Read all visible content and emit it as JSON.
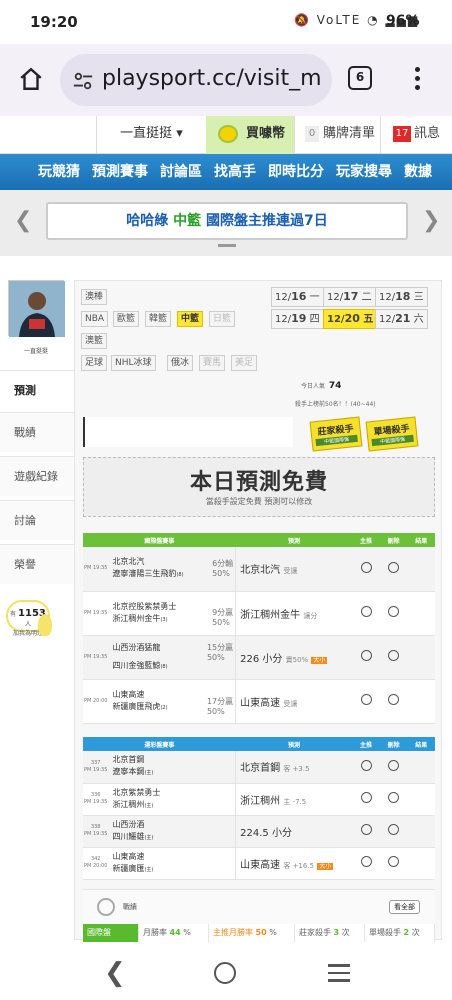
{
  "status_bar": {
    "time": "19:20",
    "icons": "🔕 VoLTE ◔ ▂▄▆",
    "battery": "96%"
  },
  "browser": {
    "url": "playsport.cc/visit_m",
    "tab_count": "6"
  },
  "top_nav": {
    "user": "一直挺挺 ▾",
    "buy": "買噱幣",
    "list_count": "0",
    "list": "購牌清單",
    "msg_count": "17",
    "msg": "訊息"
  },
  "main_nav": [
    "玩競猜",
    "預測賽事",
    "討論區",
    "找高手",
    "即時比分",
    "玩家搜尋",
    "數據"
  ],
  "banner": {
    "prefix": "哈哈綠",
    "highlight": "中籃",
    "suffix": "國際盤主推連過7日"
  },
  "profile": {
    "name": "一直挺挺"
  },
  "side_tabs": [
    "預測",
    "戰績",
    "遊戲紀錄",
    "討論",
    "榮譽"
  ],
  "fan": {
    "prefix": "有",
    "count": "1153",
    "suffix": "人",
    "line2": "加我為明燈"
  },
  "sports": {
    "row1": [
      "澳棒"
    ],
    "row2": [
      "NBA",
      "歐籃",
      "韓籃",
      "中籃",
      "日籃"
    ],
    "row3": [
      "澳籃"
    ],
    "row4": [
      "足球",
      "NHL冰球",
      "俄冰",
      "賽馬",
      "美足"
    ]
  },
  "dates": [
    {
      "md": "12/",
      "d": "16",
      "wd": "一"
    },
    {
      "md": "12/",
      "d": "17",
      "wd": "二"
    },
    {
      "md": "12/",
      "d": "18",
      "wd": "三"
    },
    {
      "md": "12/",
      "d": "19",
      "wd": "四"
    },
    {
      "md": "12/",
      "d": "20",
      "wd": "五"
    },
    {
      "md": "12/",
      "d": "21",
      "wd": "六"
    }
  ],
  "stats": {
    "today_label": "今日人氣",
    "today_value": "74",
    "rank_text": "殺手上榜前50名！！(40~44)"
  },
  "ranks": [
    {
      "title": "莊家殺手",
      "sub": "中籃國際盤"
    },
    {
      "title": "單場殺手",
      "sub": "中籃國際盤"
    }
  ],
  "free": {
    "title": "本日預測免費",
    "sub": "當殺手設定免費 預測可以修改"
  },
  "intl_table": {
    "headers": [
      "國際盤賽事",
      "預測",
      "主推",
      "刪除",
      "結果"
    ],
    "rows": [
      {
        "time_a": "PM",
        "time_b": "19:35",
        "home": "北京北汽",
        "away": "遼寧瀋陽三生飛豹",
        "away_rank": "(8)",
        "line": "6分輸",
        "pct": "50%",
        "pick": "北京北汽",
        "pick_note": "受讓",
        "tag": ""
      },
      {
        "time_a": "PM",
        "time_b": "19:35",
        "home": "北京控股紫禁勇士",
        "away": "浙江稠州金牛",
        "away_rank": "(3)",
        "line": "9分贏",
        "pct": "50%",
        "pick": "浙江稠州金牛",
        "pick_note": "讓分",
        "tag": ""
      },
      {
        "time_a": "PM",
        "time_b": "19:35",
        "home": "山西汾酒猛龍",
        "away": "四川金強藍鯨",
        "away_rank": "(8)",
        "line": "15分贏",
        "pct": "50%",
        "pick": "226 小分",
        "pick_note": "賣50%",
        "tag": "大小"
      },
      {
        "time_a": "PM",
        "time_b": "20:00",
        "home": "山東高速",
        "away": "新疆廣匯飛虎",
        "away_rank": "(2)",
        "line": "17分贏",
        "pct": "50%",
        "pick": "山東高速",
        "pick_note": "受讓",
        "tag": ""
      }
    ]
  },
  "local_table": {
    "headers": [
      "運彩盤賽事",
      "預測",
      "主推",
      "刪除",
      "結果"
    ],
    "rows": [
      {
        "num": "337",
        "time": "PM 19:35",
        "home": "北京首鋼",
        "away": "遼寧本鋼",
        "away_rank": "(主)",
        "pick": "北京首鋼",
        "pick_note": "客 +3.5",
        "tag": ""
      },
      {
        "num": "336",
        "time": "PM 19:35",
        "home": "北京紫禁勇士",
        "away": "浙江稠州",
        "away_rank": "(主)",
        "pick": "浙江稠州",
        "pick_note": "主 -7.5",
        "tag": ""
      },
      {
        "num": "338",
        "time": "PM 19:35",
        "home": "山西汾酒",
        "away": "四川鱷雄",
        "away_rank": "(主)",
        "pick": "224.5 小分",
        "pick_note": "",
        "tag": ""
      },
      {
        "num": "342",
        "time": "PM 20:00",
        "home": "山東高速",
        "away": "新疆廣匯",
        "away_rank": "(主)",
        "pick": "山東高速",
        "pick_note": "客 +16.5",
        "tag": "大小"
      }
    ]
  },
  "streak": {
    "label": "戰績",
    "all": "看全部",
    "cells": [
      {
        "name": "國際盤",
        "value": ""
      },
      {
        "name": "月勝率",
        "value": "44",
        "unit": "%"
      },
      {
        "name": "主推月勝率",
        "value": "50",
        "unit": "%"
      },
      {
        "name": "莊家殺手",
        "value": "3",
        "unit": "次"
      },
      {
        "name": "單場殺手",
        "value": "2",
        "unit": "次"
      }
    ]
  },
  "colors": {
    "green_header": "#6cc13a",
    "blue_header": "#2e9ad9",
    "accent_yellow": "#ffe633",
    "nav_blue": "#1a6fb3"
  }
}
